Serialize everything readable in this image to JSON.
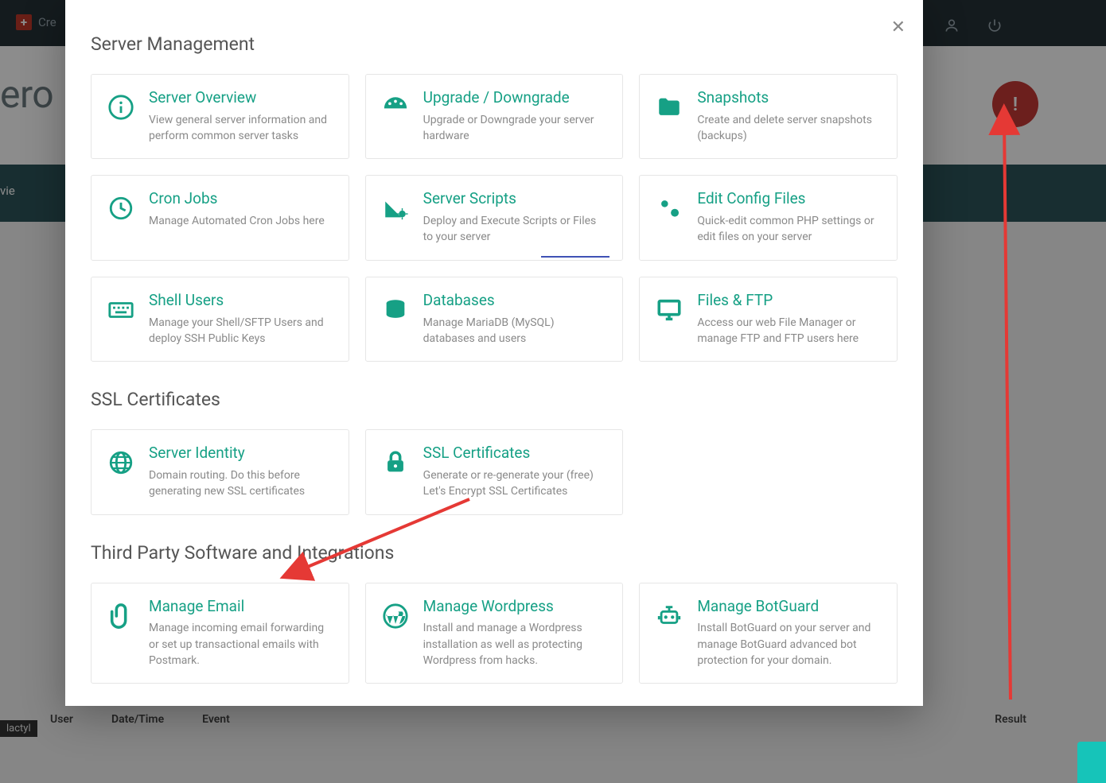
{
  "background": {
    "create_label": "Cre",
    "hero_title": "ero",
    "band_label": "vie",
    "tag_label": "lactyl",
    "table_head_user": "User",
    "table_head_datetime": "Date/Time",
    "table_head_event": "Event",
    "table_head_result": "Result"
  },
  "modal": {
    "sections": {
      "server": "Server Management",
      "ssl": "SSL Certificates",
      "third": "Third Party Software and Integrations"
    },
    "cards": {
      "overview": {
        "title": "Server Overview",
        "desc": "View general server information and perform common server tasks"
      },
      "upgrade": {
        "title": "Upgrade / Downgrade",
        "desc": "Upgrade or Downgrade your server hardware"
      },
      "snapshots": {
        "title": "Snapshots",
        "desc": "Create and delete server snapshots (backups)"
      },
      "cron": {
        "title": "Cron Jobs",
        "desc": "Manage Automated Cron Jobs here"
      },
      "scripts": {
        "title": "Server Scripts",
        "desc": "Deploy and Execute Scripts or Files to your server"
      },
      "config": {
        "title": "Edit Config Files",
        "desc": "Quick-edit common PHP settings or edit files on your server"
      },
      "shell": {
        "title": "Shell Users",
        "desc": "Manage your Shell/SFTP Users and deploy SSH Public Keys"
      },
      "databases": {
        "title": "Databases",
        "desc": "Manage MariaDB (MySQL) databases and users"
      },
      "files": {
        "title": "Files & FTP",
        "desc": "Access our web File Manager or manage FTP and FTP users here"
      },
      "identity": {
        "title": "Server Identity",
        "desc": "Domain routing. Do this before generating new SSL certificates"
      },
      "sslcerts": {
        "title": "SSL Certificates",
        "desc": "Generate or re-generate your (free) Let's Encrypt SSL Certificates"
      },
      "email": {
        "title": "Manage Email",
        "desc": "Manage incoming email forwarding or set up transactional emails with Postmark."
      },
      "wordpress": {
        "title": "Manage Wordpress",
        "desc": "Install and manage a Wordpress installation as well as protecting Wordpress from hacks."
      },
      "botguard": {
        "title": "Manage BotGuard",
        "desc": "Install BotGuard on your server and manage BotGuard advanced bot protection for your domain."
      }
    }
  }
}
